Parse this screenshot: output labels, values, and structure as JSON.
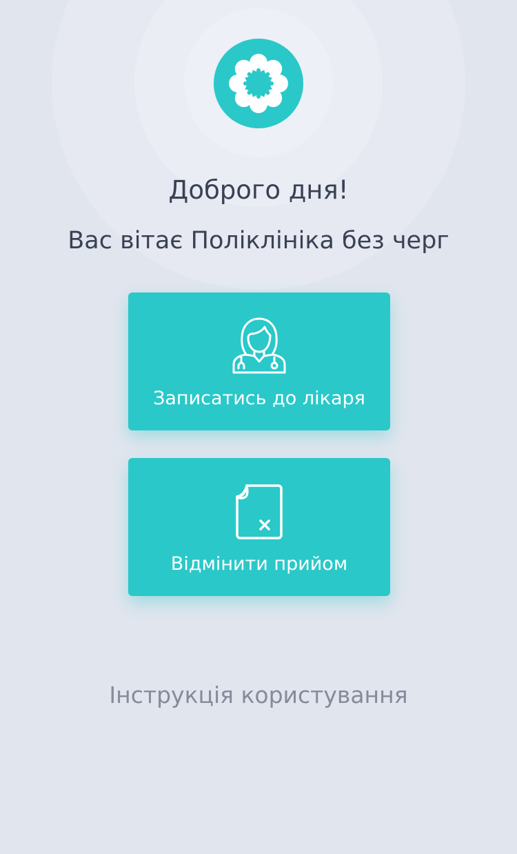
{
  "header": {
    "logo_icon": "flower-icon",
    "greeting": "Доброго дня!",
    "subtitle": "Вас вітає Поліклініка без черг"
  },
  "actions": [
    {
      "label": "Записатись до лікаря",
      "icon": "doctor-icon"
    },
    {
      "label": "Відмінити прийом",
      "icon": "cancel-document-icon"
    }
  ],
  "footer": {
    "instructions_link": "Інструкція користування"
  },
  "colors": {
    "background": "#e1e5ee",
    "accent": "#2ac8c9",
    "text_dark": "#3a4155",
    "text_muted": "#858b9a"
  }
}
